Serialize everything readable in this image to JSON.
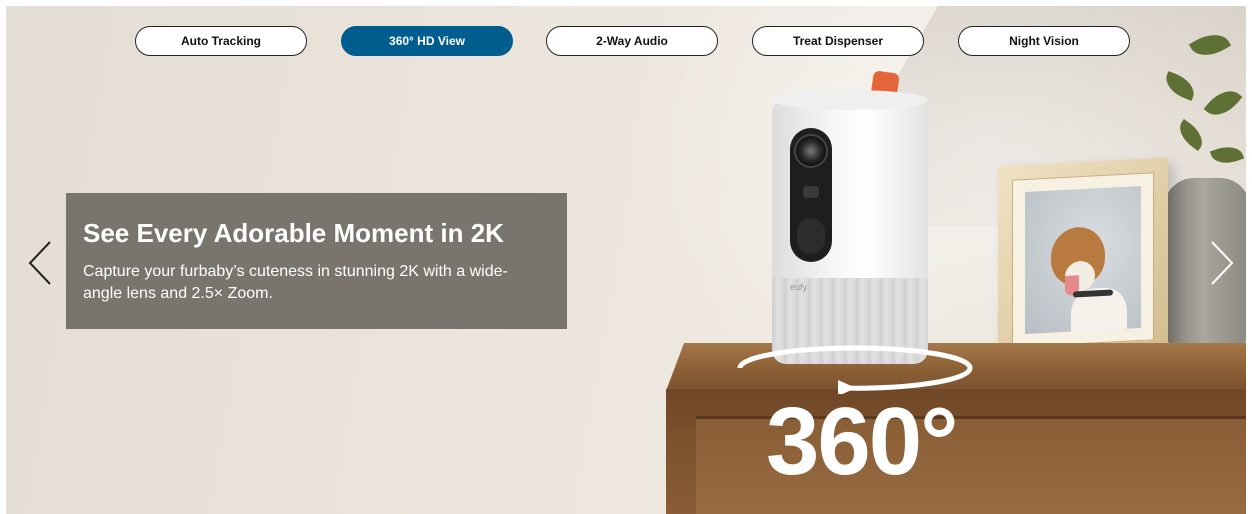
{
  "tabs": [
    {
      "label": "Auto Tracking",
      "active": false
    },
    {
      "label": "360° HD View",
      "active": true
    },
    {
      "label": "2-Way Audio",
      "active": false
    },
    {
      "label": "Treat Dispenser",
      "active": false
    },
    {
      "label": "Night Vision",
      "active": false
    }
  ],
  "slide": {
    "heading": "See Every Adorable Moment in 2K",
    "description": "Capture your furbaby’s cuteness in stunning 2K with a wide-angle lens and 2.5× Zoom.",
    "overlay_text": "360°",
    "camera_brand": "eufy"
  },
  "icons": {
    "prev": "chevron-left-icon",
    "next": "chevron-right-icon"
  },
  "colors": {
    "active_tab": "#005d8e",
    "card_bg": "#706c64"
  }
}
